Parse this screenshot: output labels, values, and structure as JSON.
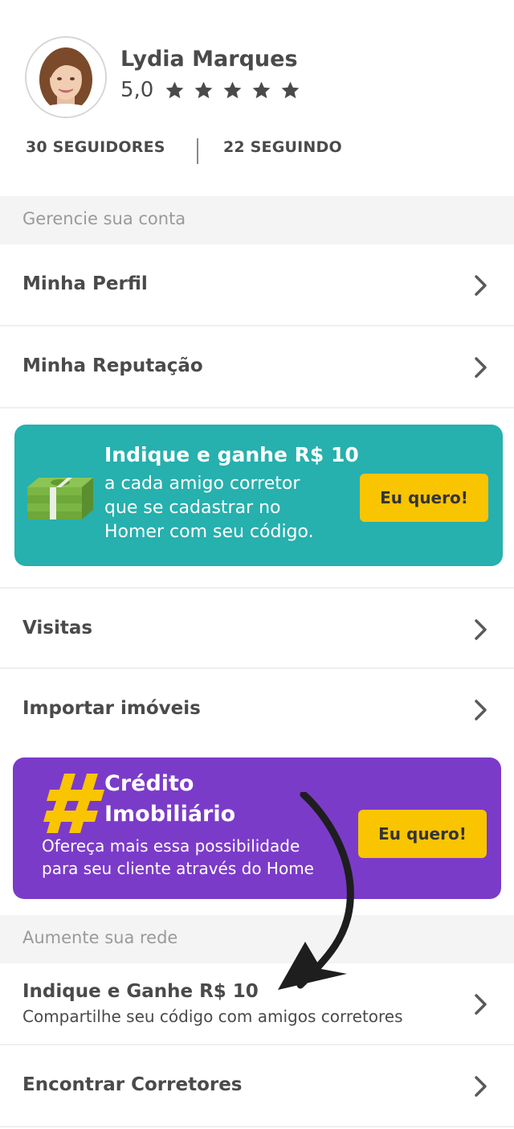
{
  "profile": {
    "name": "Lydia Marques",
    "rating": "5,0",
    "stars": 5,
    "followers": "30 SEGUIDORES",
    "following": "22 SEGUINDO"
  },
  "section_account": "Gerencie sua conta",
  "menu": {
    "profile": "Minha Perfil",
    "reputation": "Minha Reputação",
    "visits": "Visitas",
    "import": "Importar imóveis",
    "refer": "Indique e Ganhe R$ 10",
    "refer_sub": "Compartilhe seu código com amigos corretores",
    "find": "Encontrar Corretores"
  },
  "promo_refer": {
    "title": "Indique e ganhe R$ 10",
    "line1": "a cada amigo corretor",
    "line2": "que se cadastrar no",
    "line3": "Homer com seu código.",
    "button": "Eu quero!"
  },
  "promo_credit": {
    "title1": "Crédito",
    "title2": "Imobiliário",
    "line1": "Ofereça mais essa possibilidade",
    "line2": "para seu cliente através do Home",
    "button": "Eu quero!"
  },
  "section_network": "Aumente sua rede",
  "colors": {
    "teal": "#26b0ae",
    "purple": "#7b3bc9",
    "yellow": "#f9c400",
    "text": "#4a4a4a"
  }
}
